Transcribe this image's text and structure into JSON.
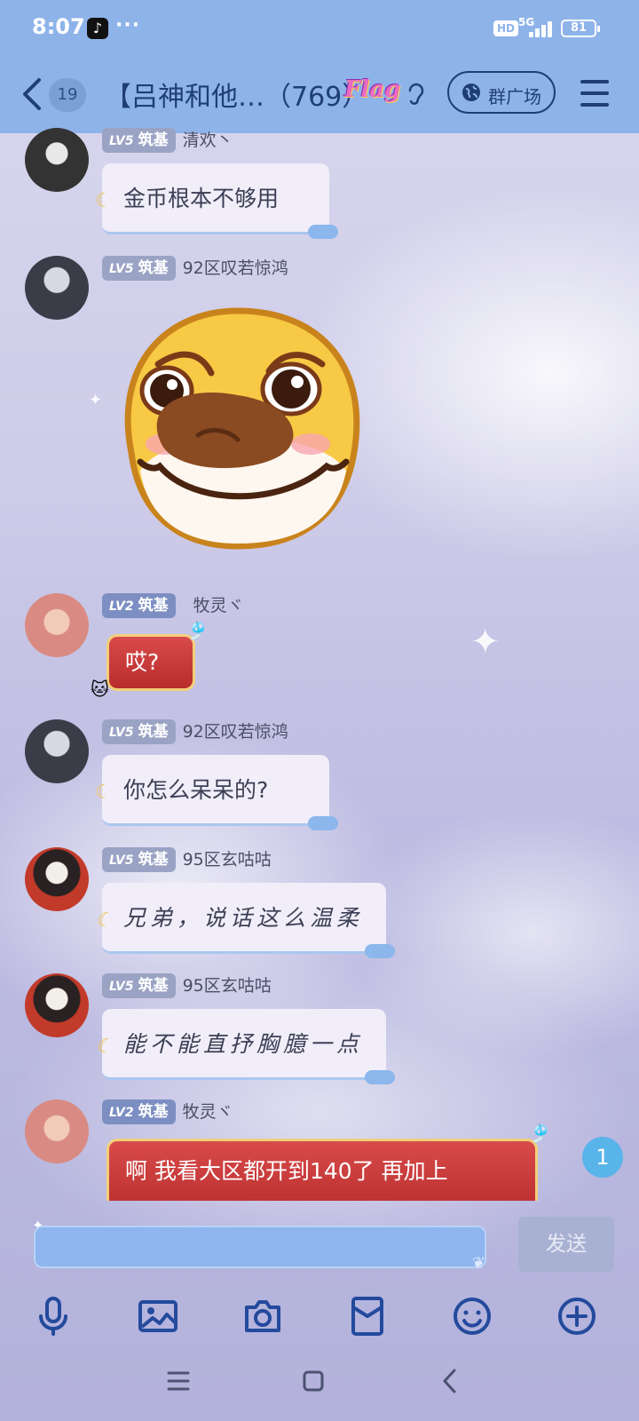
{
  "status_bar": {
    "time": "8:07",
    "more": "···",
    "hd": "HD",
    "network": "5G",
    "battery": "81"
  },
  "header": {
    "unread_count": "19",
    "group_title": "【吕神和他…（769）",
    "flag_text": "Flag",
    "square_label": "群广场"
  },
  "messages": [
    {
      "level": "LV5",
      "rank": "筑基",
      "nickname": "清欢丶",
      "text": "金币根本不够用",
      "type": "text"
    },
    {
      "level": "LV5",
      "rank": "筑基",
      "nickname": "92区叹若惊鸿",
      "type": "sticker",
      "sticker_name": "shy-dog-sticker"
    },
    {
      "level": "LV2",
      "rank": "筑基",
      "nickname": "牧灵ヾ",
      "text": "哎?",
      "type": "red-text"
    },
    {
      "level": "LV5",
      "rank": "筑基",
      "nickname": "92区叹若惊鸿",
      "text": "你怎么呆呆的?",
      "type": "text"
    },
    {
      "level": "LV5",
      "rank": "筑基",
      "nickname": "95区玄咕咕",
      "text": "兄弟，说话这么温柔",
      "type": "script"
    },
    {
      "level": "LV5",
      "rank": "筑基",
      "nickname": "95区玄咕咕",
      "text": "能不能直抒胸臆一点",
      "type": "script"
    },
    {
      "level": "LV2",
      "rank": "筑基",
      "nickname": "牧灵ヾ",
      "text": "啊 我看大区都开到140了 再加上",
      "type": "red-text"
    }
  ],
  "new_message_count": "1",
  "input": {
    "placeholder": "",
    "send_label": "发送"
  },
  "toolbar": {
    "icons": [
      "microphone-icon",
      "image-icon",
      "camera-icon",
      "red-packet-icon",
      "emoji-icon",
      "plus-icon"
    ]
  },
  "colors": {
    "header_bg": "#8eb3e9",
    "accent": "#1f3e78",
    "bubble_bg": "#f1eef9",
    "red_bubble": "#c83a3a"
  }
}
